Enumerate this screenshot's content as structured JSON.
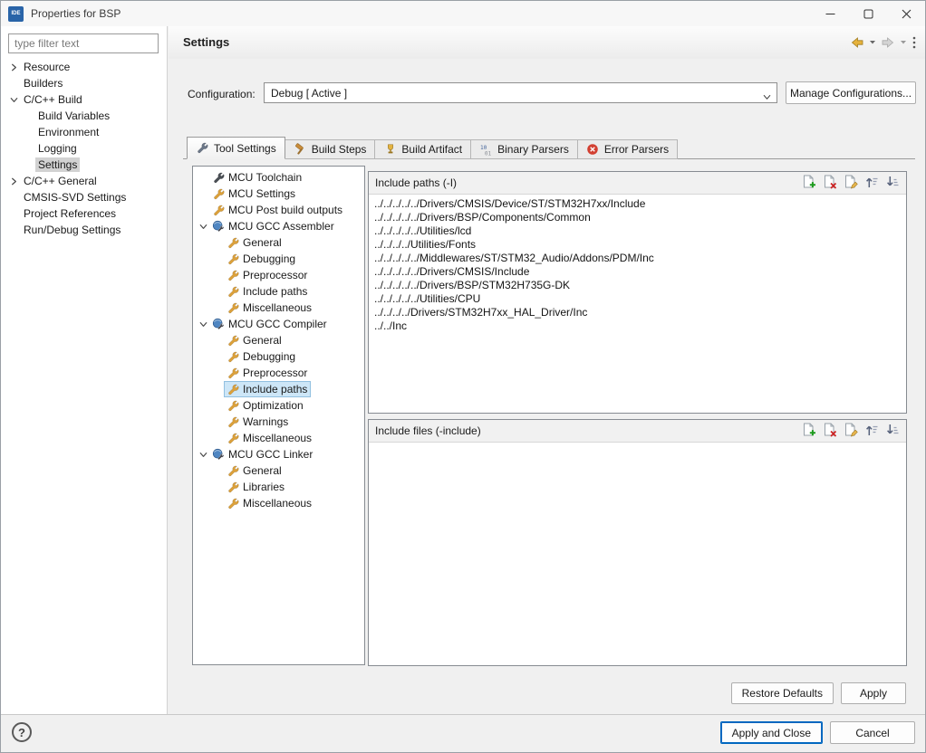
{
  "window": {
    "title": "Properties for BSP",
    "app_icon_label": "IDE"
  },
  "sidebar": {
    "filter_placeholder": "type filter text",
    "tree": [
      {
        "label": "Resource",
        "expand": "collapsed",
        "indent": 0
      },
      {
        "label": "Builders",
        "expand": "none",
        "indent": 0
      },
      {
        "label": "C/C++ Build",
        "expand": "expanded",
        "indent": 0
      },
      {
        "label": "Build Variables",
        "expand": "none",
        "indent": 1
      },
      {
        "label": "Environment",
        "expand": "none",
        "indent": 1
      },
      {
        "label": "Logging",
        "expand": "none",
        "indent": 1
      },
      {
        "label": "Settings",
        "expand": "none",
        "indent": 1,
        "selected": true
      },
      {
        "label": "C/C++ General",
        "expand": "collapsed",
        "indent": 0
      },
      {
        "label": "CMSIS-SVD Settings",
        "expand": "none",
        "indent": 0
      },
      {
        "label": "Project References",
        "expand": "none",
        "indent": 0
      },
      {
        "label": "Run/Debug Settings",
        "expand": "none",
        "indent": 0
      }
    ]
  },
  "header": {
    "title": "Settings"
  },
  "configuration": {
    "label": "Configuration:",
    "value": "Debug  [ Active ]",
    "manage_button": "Manage Configurations..."
  },
  "tabs": [
    {
      "label": "Tool Settings",
      "icon": "wrench-tab",
      "active": true
    },
    {
      "label": "Build Steps",
      "icon": "hammer",
      "active": false
    },
    {
      "label": "Build Artifact",
      "icon": "artifact",
      "active": false
    },
    {
      "label": "Binary Parsers",
      "icon": "binary",
      "active": false
    },
    {
      "label": "Error Parsers",
      "icon": "error",
      "active": false
    }
  ],
  "tool_tree": [
    {
      "label": "MCU Toolchain",
      "icon": "wrench-dark",
      "indent": 0
    },
    {
      "label": "MCU Settings",
      "icon": "wrench-amber",
      "indent": 0
    },
    {
      "label": "MCU Post build outputs",
      "icon": "wrench-amber",
      "indent": 0
    },
    {
      "label": "MCU GCC Assembler",
      "icon": "sphere",
      "indent": 0,
      "expanded": true
    },
    {
      "label": "General",
      "icon": "wrench-amber",
      "indent": 1
    },
    {
      "label": "Debugging",
      "icon": "wrench-amber",
      "indent": 1
    },
    {
      "label": "Preprocessor",
      "icon": "wrench-amber",
      "indent": 1
    },
    {
      "label": "Include paths",
      "icon": "wrench-amber",
      "indent": 1
    },
    {
      "label": "Miscellaneous",
      "icon": "wrench-amber",
      "indent": 1
    },
    {
      "label": "MCU GCC Compiler",
      "icon": "sphere",
      "indent": 0,
      "expanded": true
    },
    {
      "label": "General",
      "icon": "wrench-amber",
      "indent": 1
    },
    {
      "label": "Debugging",
      "icon": "wrench-amber",
      "indent": 1
    },
    {
      "label": "Preprocessor",
      "icon": "wrench-amber",
      "indent": 1
    },
    {
      "label": "Include paths",
      "icon": "wrench-amber",
      "indent": 1,
      "selected": true
    },
    {
      "label": "Optimization",
      "icon": "wrench-amber",
      "indent": 1
    },
    {
      "label": "Warnings",
      "icon": "wrench-amber",
      "indent": 1
    },
    {
      "label": "Miscellaneous",
      "icon": "wrench-amber",
      "indent": 1
    },
    {
      "label": "MCU GCC Linker",
      "icon": "sphere",
      "indent": 0,
      "expanded": true
    },
    {
      "label": "General",
      "icon": "wrench-amber",
      "indent": 1
    },
    {
      "label": "Libraries",
      "icon": "wrench-amber",
      "indent": 1
    },
    {
      "label": "Miscellaneous",
      "icon": "wrench-amber",
      "indent": 1
    }
  ],
  "include_paths": {
    "title": "Include paths (-I)",
    "toolbar": [
      "add",
      "delete",
      "edit",
      "move-up",
      "move-down"
    ],
    "items": [
      "../../../../../Drivers/CMSIS/Device/ST/STM32H7xx/Include",
      "../../../../../Drivers/BSP/Components/Common",
      "../../../../../Utilities/lcd",
      "../../../../Utilities/Fonts",
      "../../../../../Middlewares/ST/STM32_Audio/Addons/PDM/Inc",
      "../../../../../Drivers/CMSIS/Include",
      "../../../../../Drivers/BSP/STM32H735G-DK",
      "../../../../../Utilities/CPU",
      "../../../../Drivers/STM32H7xx_HAL_Driver/Inc",
      "../../Inc"
    ]
  },
  "include_files": {
    "title": "Include files (-include)",
    "toolbar": [
      "add",
      "delete",
      "edit",
      "move-up",
      "move-down"
    ],
    "items": []
  },
  "buttons": {
    "restore_defaults": "Restore Defaults",
    "apply": "Apply",
    "apply_and_close": "Apply and Close",
    "cancel": "Cancel"
  },
  "footer": {
    "help_label": "?"
  }
}
